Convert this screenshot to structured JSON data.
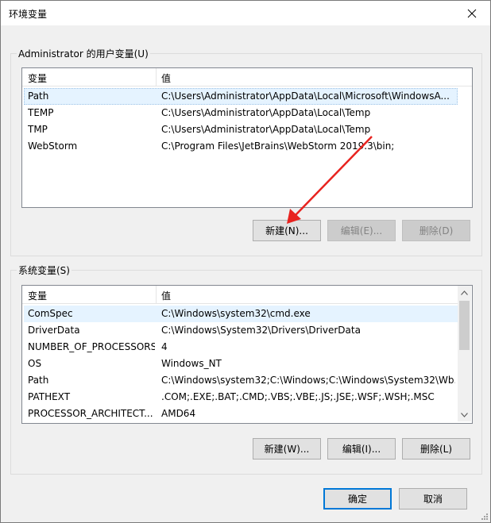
{
  "window": {
    "title": "环境变量",
    "close_label": "×"
  },
  "user_vars": {
    "group_label": "Administrator 的用户变量(U)",
    "columns": [
      "变量",
      "值"
    ],
    "rows": [
      {
        "name": "Path",
        "value": "C:\\Users\\Administrator\\AppData\\Local\\Microsoft\\WindowsA..."
      },
      {
        "name": "TEMP",
        "value": "C:\\Users\\Administrator\\AppData\\Local\\Temp"
      },
      {
        "name": "TMP",
        "value": "C:\\Users\\Administrator\\AppData\\Local\\Temp"
      },
      {
        "name": "WebStorm",
        "value": "C:\\Program Files\\JetBrains\\WebStorm 2019.3\\bin;"
      }
    ],
    "buttons": {
      "new": "新建(N)...",
      "edit": "编辑(E)...",
      "delete": "删除(D)"
    }
  },
  "system_vars": {
    "group_label": "系统变量(S)",
    "columns": [
      "变量",
      "值"
    ],
    "rows": [
      {
        "name": "ComSpec",
        "value": "C:\\Windows\\system32\\cmd.exe"
      },
      {
        "name": "DriverData",
        "value": "C:\\Windows\\System32\\Drivers\\DriverData"
      },
      {
        "name": "NUMBER_OF_PROCESSORS",
        "value": "4"
      },
      {
        "name": "OS",
        "value": "Windows_NT"
      },
      {
        "name": "Path",
        "value": "C:\\Windows\\system32;C:\\Windows;C:\\Windows\\System32\\Wb..."
      },
      {
        "name": "PATHEXT",
        "value": ".COM;.EXE;.BAT;.CMD;.VBS;.VBE;.JS;.JSE;.WSF;.WSH;.MSC"
      },
      {
        "name": "PROCESSOR_ARCHITECT...",
        "value": "AMD64"
      }
    ],
    "buttons": {
      "new": "新建(W)...",
      "edit": "编辑(I)...",
      "delete": "删除(L)"
    }
  },
  "footer": {
    "ok": "确定",
    "cancel": "取消"
  },
  "colors": {
    "annotation_arrow": "#e8231f",
    "selection": "#e5f3ff",
    "default_button_border": "#0078d7"
  }
}
